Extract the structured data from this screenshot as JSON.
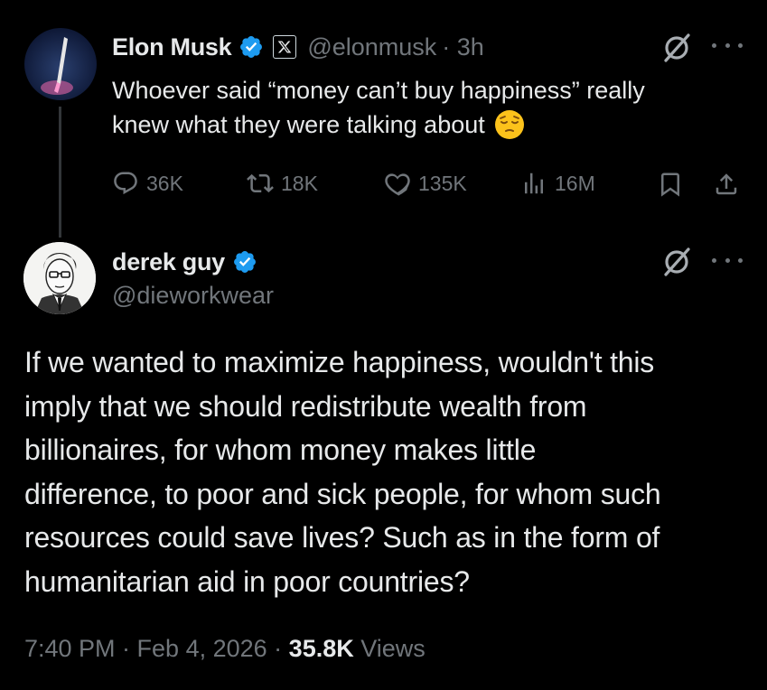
{
  "reply_to": {
    "author_name": "Elon Musk",
    "handle": "@elonmusk",
    "time": "· 3h",
    "text_line1": "Whoever said “money can’t buy happiness” really",
    "text_line2": "knew what they were talking about",
    "emoji": "😔",
    "metrics": {
      "replies": "36K",
      "reposts": "18K",
      "likes": "135K",
      "views": "16M"
    }
  },
  "tweet": {
    "author_name": "derek guy",
    "handle": "@dieworkwear",
    "lines": [
      "If we wanted to maximize happiness, wouldn't this",
      "imply that we should redistribute wealth from",
      "billionaires, for whom money makes little",
      "difference, to poor and sick people, for whom such",
      "resources could save lives? Such as in the form of",
      "humanitarian aid in poor countries?"
    ],
    "timestamp": "7:40 PM · Feb 4, 2026 ·",
    "views_count": "35.8K",
    "views_label": "Views"
  },
  "colors": {
    "background": "#000000",
    "text": "#e7e9ea",
    "muted": "#71767b",
    "verified": "#1d9bf0"
  },
  "icons": [
    "verified-badge-icon",
    "x-logo-icon",
    "grok-icon",
    "more-icon",
    "reply-icon",
    "repost-icon",
    "like-icon",
    "views-icon",
    "bookmark-icon",
    "share-icon"
  ]
}
